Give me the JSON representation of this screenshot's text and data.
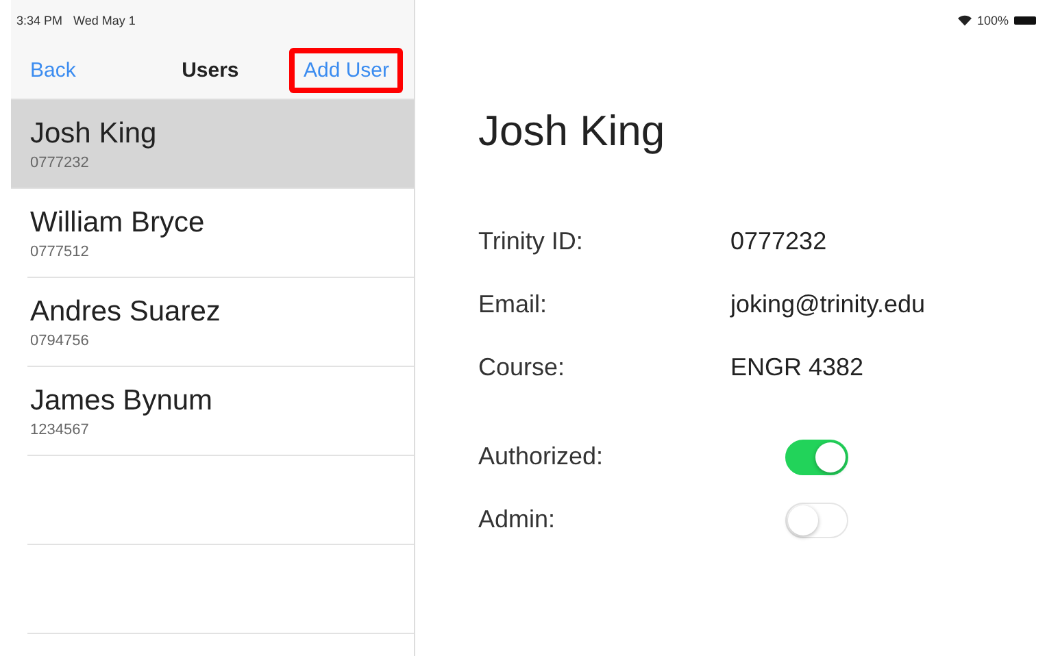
{
  "status_bar": {
    "time": "3:34 PM",
    "date": "Wed May 1",
    "battery": "100%"
  },
  "nav": {
    "back": "Back",
    "title": "Users",
    "action": "Add User",
    "action_highlighted": true
  },
  "users": [
    {
      "name": "Josh King",
      "id": "0777232",
      "selected": true
    },
    {
      "name": "William Bryce",
      "id": "0777512",
      "selected": false
    },
    {
      "name": "Andres Suarez",
      "id": "0794756",
      "selected": false
    },
    {
      "name": "James Bynum",
      "id": "1234567",
      "selected": false
    }
  ],
  "detail": {
    "title": "Josh King",
    "fields": [
      {
        "label": "Trinity ID:",
        "value": "0777232"
      },
      {
        "label": "Email:",
        "value": "joking@trinity.edu"
      },
      {
        "label": "Course:",
        "value": "ENGR 4382"
      }
    ],
    "switches": [
      {
        "label": "Authorized:",
        "on": true
      },
      {
        "label": "Admin:",
        "on": false
      }
    ]
  }
}
